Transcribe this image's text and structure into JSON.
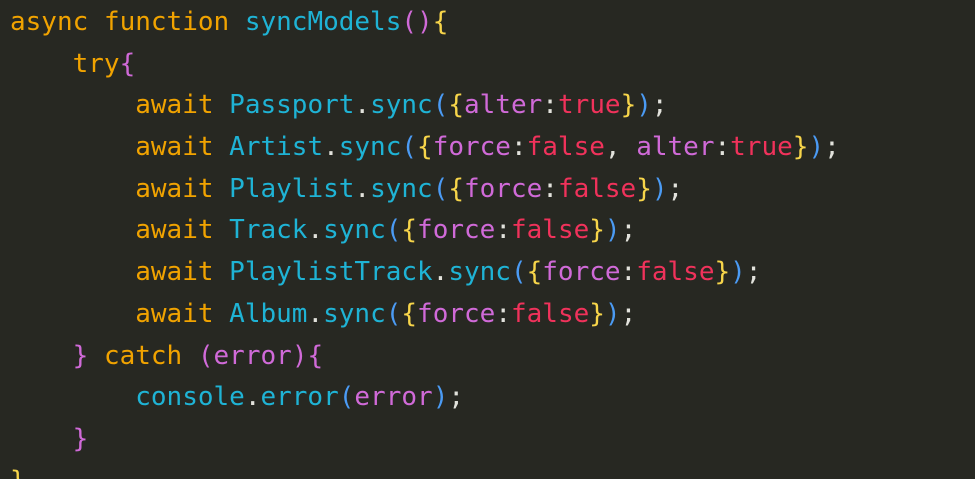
{
  "theme": {
    "background": "#272822",
    "colors": {
      "keyword": "#f1a300",
      "func": "#1fb3d5",
      "ident": "#1fb3d5",
      "punct": "#e2e2dc",
      "bracket1": "#f7d54a",
      "bracket2": "#d06ad8",
      "bracket3": "#4b9bf4",
      "key": "#d06ad8",
      "bool": "#f0325b",
      "var": "#d06ad8"
    }
  },
  "editor": {
    "lines": [
      {
        "indent": 0,
        "tokens": [
          {
            "t": "async",
            "c": "keyword"
          },
          {
            "t": " ",
            "c": "punct"
          },
          {
            "t": "function",
            "c": "keyword"
          },
          {
            "t": " ",
            "c": "punct"
          },
          {
            "t": "syncModels",
            "c": "func"
          },
          {
            "t": "()",
            "c": "bracket2"
          },
          {
            "t": "{",
            "c": "bracket1"
          }
        ]
      },
      {
        "indent": 1,
        "tokens": [
          {
            "t": "try",
            "c": "keyword"
          },
          {
            "t": "{",
            "c": "bracket2"
          }
        ]
      },
      {
        "indent": 2,
        "tokens": [
          {
            "t": "await",
            "c": "keyword"
          },
          {
            "t": " ",
            "c": "punct"
          },
          {
            "t": "Passport",
            "c": "ident"
          },
          {
            "t": ".",
            "c": "punct"
          },
          {
            "t": "sync",
            "c": "func"
          },
          {
            "t": "(",
            "c": "bracket3"
          },
          {
            "t": "{",
            "c": "bracket1"
          },
          {
            "t": "alter",
            "c": "key"
          },
          {
            "t": ":",
            "c": "punct"
          },
          {
            "t": "true",
            "c": "bool"
          },
          {
            "t": "}",
            "c": "bracket1"
          },
          {
            "t": ")",
            "c": "bracket3"
          },
          {
            "t": ";",
            "c": "punct"
          }
        ]
      },
      {
        "indent": 2,
        "tokens": [
          {
            "t": "await",
            "c": "keyword"
          },
          {
            "t": " ",
            "c": "punct"
          },
          {
            "t": "Artist",
            "c": "ident"
          },
          {
            "t": ".",
            "c": "punct"
          },
          {
            "t": "sync",
            "c": "func"
          },
          {
            "t": "(",
            "c": "bracket3"
          },
          {
            "t": "{",
            "c": "bracket1"
          },
          {
            "t": "force",
            "c": "key"
          },
          {
            "t": ":",
            "c": "punct"
          },
          {
            "t": "false",
            "c": "bool"
          },
          {
            "t": ", ",
            "c": "punct"
          },
          {
            "t": "alter",
            "c": "key"
          },
          {
            "t": ":",
            "c": "punct"
          },
          {
            "t": "true",
            "c": "bool"
          },
          {
            "t": "}",
            "c": "bracket1"
          },
          {
            "t": ")",
            "c": "bracket3"
          },
          {
            "t": ";",
            "c": "punct"
          }
        ]
      },
      {
        "indent": 2,
        "tokens": [
          {
            "t": "await",
            "c": "keyword"
          },
          {
            "t": " ",
            "c": "punct"
          },
          {
            "t": "Playlist",
            "c": "ident"
          },
          {
            "t": ".",
            "c": "punct"
          },
          {
            "t": "sync",
            "c": "func"
          },
          {
            "t": "(",
            "c": "bracket3"
          },
          {
            "t": "{",
            "c": "bracket1"
          },
          {
            "t": "force",
            "c": "key"
          },
          {
            "t": ":",
            "c": "punct"
          },
          {
            "t": "false",
            "c": "bool"
          },
          {
            "t": "}",
            "c": "bracket1"
          },
          {
            "t": ")",
            "c": "bracket3"
          },
          {
            "t": ";",
            "c": "punct"
          }
        ]
      },
      {
        "indent": 2,
        "tokens": [
          {
            "t": "await",
            "c": "keyword"
          },
          {
            "t": " ",
            "c": "punct"
          },
          {
            "t": "Track",
            "c": "ident"
          },
          {
            "t": ".",
            "c": "punct"
          },
          {
            "t": "sync",
            "c": "func"
          },
          {
            "t": "(",
            "c": "bracket3"
          },
          {
            "t": "{",
            "c": "bracket1"
          },
          {
            "t": "force",
            "c": "key"
          },
          {
            "t": ":",
            "c": "punct"
          },
          {
            "t": "false",
            "c": "bool"
          },
          {
            "t": "}",
            "c": "bracket1"
          },
          {
            "t": ")",
            "c": "bracket3"
          },
          {
            "t": ";",
            "c": "punct"
          }
        ]
      },
      {
        "indent": 2,
        "tokens": [
          {
            "t": "await",
            "c": "keyword"
          },
          {
            "t": " ",
            "c": "punct"
          },
          {
            "t": "PlaylistTrack",
            "c": "ident"
          },
          {
            "t": ".",
            "c": "punct"
          },
          {
            "t": "sync",
            "c": "func"
          },
          {
            "t": "(",
            "c": "bracket3"
          },
          {
            "t": "{",
            "c": "bracket1"
          },
          {
            "t": "force",
            "c": "key"
          },
          {
            "t": ":",
            "c": "punct"
          },
          {
            "t": "false",
            "c": "bool"
          },
          {
            "t": "}",
            "c": "bracket1"
          },
          {
            "t": ")",
            "c": "bracket3"
          },
          {
            "t": ";",
            "c": "punct"
          }
        ]
      },
      {
        "indent": 2,
        "tokens": [
          {
            "t": "await",
            "c": "keyword"
          },
          {
            "t": " ",
            "c": "punct"
          },
          {
            "t": "Album",
            "c": "ident"
          },
          {
            "t": ".",
            "c": "punct"
          },
          {
            "t": "sync",
            "c": "func"
          },
          {
            "t": "(",
            "c": "bracket3"
          },
          {
            "t": "{",
            "c": "bracket1"
          },
          {
            "t": "force",
            "c": "key"
          },
          {
            "t": ":",
            "c": "punct"
          },
          {
            "t": "false",
            "c": "bool"
          },
          {
            "t": "}",
            "c": "bracket1"
          },
          {
            "t": ")",
            "c": "bracket3"
          },
          {
            "t": ";",
            "c": "punct"
          }
        ]
      },
      {
        "indent": 1,
        "tokens": [
          {
            "t": "}",
            "c": "bracket2"
          },
          {
            "t": " ",
            "c": "punct"
          },
          {
            "t": "catch",
            "c": "keyword"
          },
          {
            "t": " ",
            "c": "punct"
          },
          {
            "t": "(",
            "c": "bracket2"
          },
          {
            "t": "error",
            "c": "var"
          },
          {
            "t": ")",
            "c": "bracket2"
          },
          {
            "t": "{",
            "c": "bracket2"
          }
        ]
      },
      {
        "indent": 2,
        "tokens": [
          {
            "t": "console",
            "c": "ident"
          },
          {
            "t": ".",
            "c": "punct"
          },
          {
            "t": "error",
            "c": "func"
          },
          {
            "t": "(",
            "c": "bracket3"
          },
          {
            "t": "error",
            "c": "var"
          },
          {
            "t": ")",
            "c": "bracket3"
          },
          {
            "t": ";",
            "c": "punct"
          }
        ]
      },
      {
        "indent": 1,
        "tokens": [
          {
            "t": "}",
            "c": "bracket2"
          }
        ]
      },
      {
        "indent": 0,
        "tokens": [
          {
            "t": "}",
            "c": "bracket1"
          }
        ]
      }
    ]
  }
}
